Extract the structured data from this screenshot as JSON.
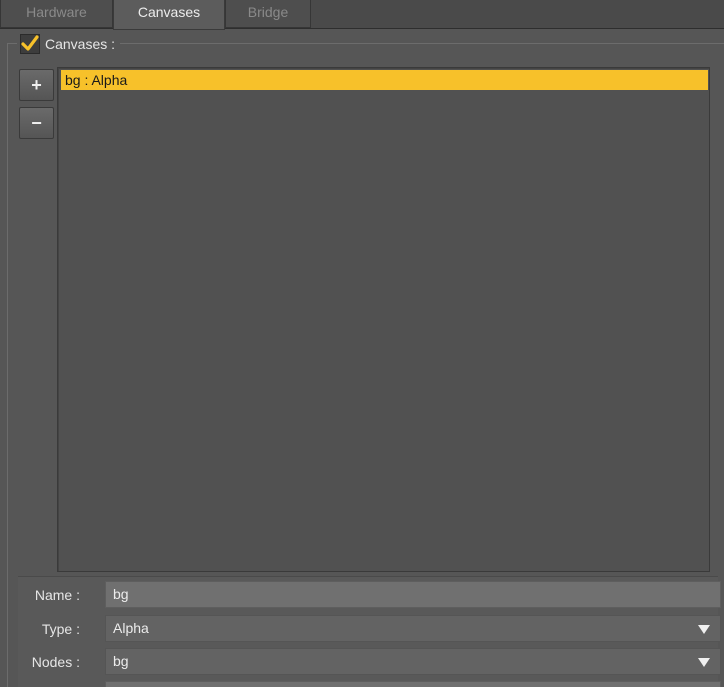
{
  "tabs": [
    {
      "label": "Hardware",
      "active": false
    },
    {
      "label": "Canvases",
      "active": true
    },
    {
      "label": "Bridge",
      "active": false
    }
  ],
  "group": {
    "label": "Canvases :",
    "checked": true,
    "check_color": "#f7c12a"
  },
  "buttons": {
    "add_label": "+",
    "remove_label": "−"
  },
  "canvas_list": {
    "items": [
      {
        "label": "bg : Alpha",
        "selected": true
      }
    ],
    "selection_color": "#f7c12a"
  },
  "properties": {
    "name": {
      "label": "Name :",
      "value": "bg"
    },
    "type": {
      "label": "Type :",
      "value": "Alpha"
    },
    "nodes": {
      "label": "Nodes :",
      "value": "bg"
    }
  }
}
